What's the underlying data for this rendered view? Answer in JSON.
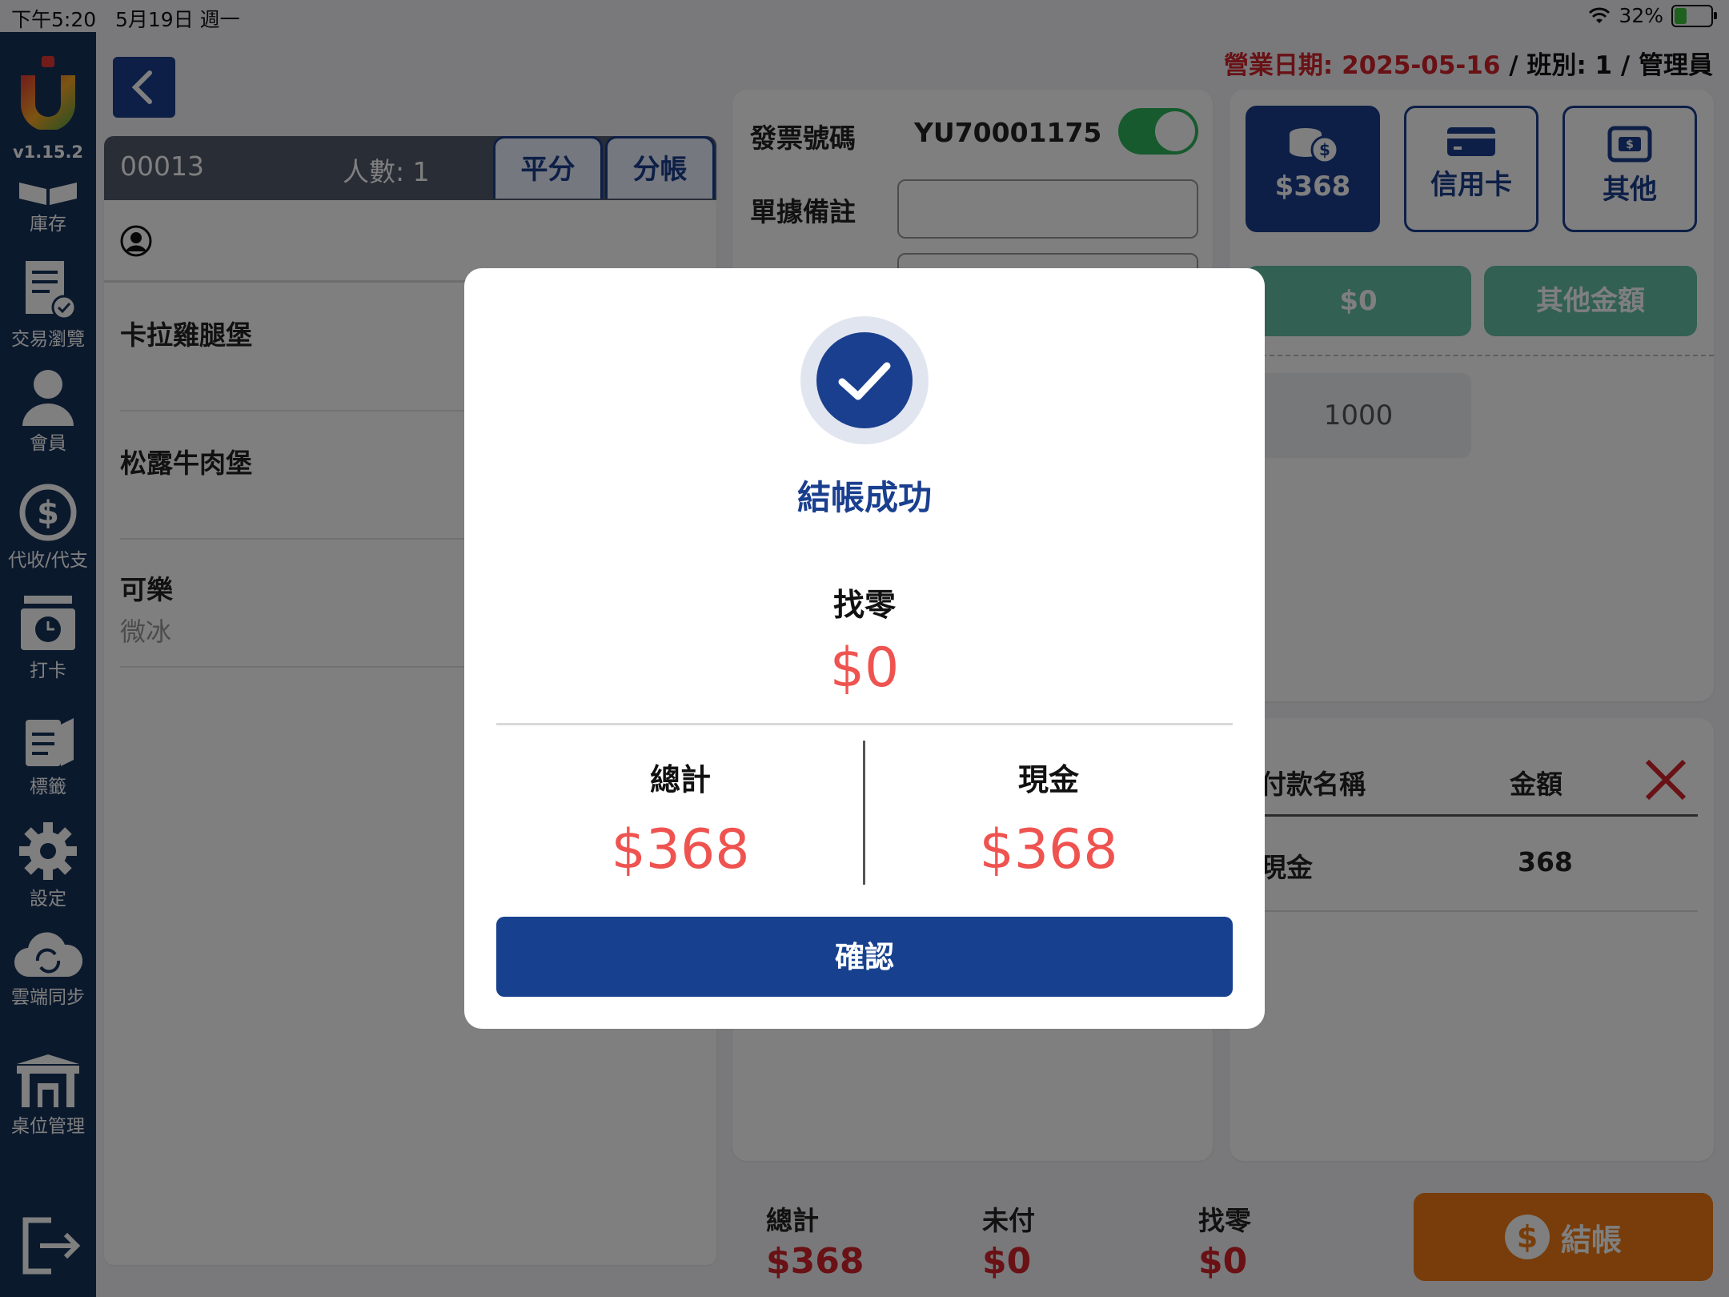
{
  "status_bar": {
    "time": "下午5:20",
    "date": "5月19日 週一",
    "battery": "32%"
  },
  "sidebar": {
    "version": "v1.15.2",
    "items": [
      {
        "label": "庫存",
        "icon": "inventory-icon"
      },
      {
        "label": "交易瀏覽",
        "icon": "receipt-icon"
      },
      {
        "label": "會員",
        "icon": "member-icon"
      },
      {
        "label": "代收/代支",
        "icon": "dollar-cycle-icon"
      },
      {
        "label": "打卡",
        "icon": "clock-in-icon"
      },
      {
        "label": "標籤",
        "icon": "label-icon"
      },
      {
        "label": "設定",
        "icon": "gear-icon"
      },
      {
        "label": "雲端同步",
        "icon": "cloud-sync-icon"
      },
      {
        "label": "桌位管理",
        "icon": "table-icon"
      }
    ]
  },
  "header": {
    "business_date_label": "營業日期: ",
    "business_date": "2025-05-16",
    "shift_info": " / 班別: 1 / 管理員"
  },
  "order": {
    "number": "00013",
    "persons": "人數: 1",
    "tab_split_equal": "平分",
    "tab_split_bill": "分帳",
    "items": [
      {
        "name": "卡拉雞腿堡",
        "note": ""
      },
      {
        "name": "松露牛肉堡",
        "note": ""
      },
      {
        "name": "可樂",
        "note": "微冰"
      }
    ]
  },
  "invoice": {
    "label": "發票號碼",
    "value": "YU70001175",
    "note_label": "單據備註"
  },
  "payment": {
    "methods": [
      {
        "label": "$368",
        "icon": "coins-icon"
      },
      {
        "label": "信用卡",
        "icon": "credit-card-icon"
      },
      {
        "label": "其他",
        "icon": "wallet-icon"
      }
    ],
    "quick_zero": "$0",
    "quick_other": "其他金額",
    "amount_1000": "1000",
    "list_header_name": "付款名稱",
    "list_header_amount": "金額",
    "list_rows": [
      {
        "name": "現金",
        "amount": "368"
      }
    ]
  },
  "totals": {
    "total_label": "總計",
    "total_value": "$368",
    "unpaid_label": "未付",
    "unpaid_value": "$0",
    "change_label": "找零",
    "change_value": "$0",
    "checkout_label": "結帳"
  },
  "modal": {
    "title": "結帳成功",
    "change_label": "找零",
    "change_value": "$0",
    "total_label": "總計",
    "total_value": "$368",
    "cash_label": "現金",
    "cash_value": "$368",
    "confirm_label": "確認"
  },
  "colors": {
    "brand": "#1a3f8f",
    "accent_red": "#ef5350",
    "checkout_orange": "#f07a14",
    "quick_green": "#65c1a6"
  }
}
